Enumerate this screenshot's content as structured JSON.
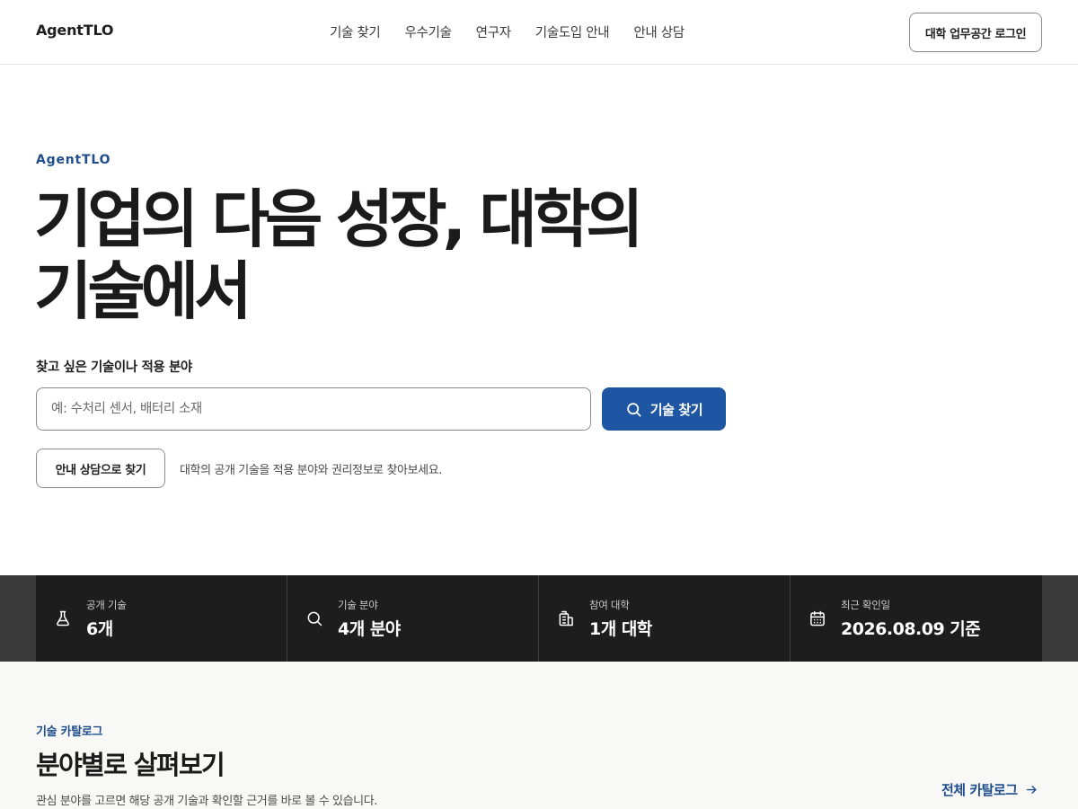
{
  "header": {
    "logo": "AgentTLO",
    "nav": [
      "기술 찾기",
      "우수기술",
      "연구자",
      "기술도입 안내",
      "안내 상담"
    ],
    "login_label": "대학 업무공간 로그인"
  },
  "hero": {
    "eyebrow": "AgentTLO",
    "title_line1": "기업의 다음 성장, 대학의",
    "title_line2": "기술에서",
    "search_label": "찾고 싶은 기술이나 적용 분야",
    "search_value": "",
    "search_placeholder": "예: 수처리 센서, 배터리 소재",
    "search_button": "기술 찾기",
    "consult_button": "안내 상담으로 찾기",
    "helper_text": "대학의 공개 기술을 적용 분야와 권리정보로 찾아보세요."
  },
  "stats": [
    {
      "icon": "flask-icon",
      "label": "공개 기술",
      "value": "6개"
    },
    {
      "icon": "search-icon",
      "label": "기술 분야",
      "value": "4개 분야"
    },
    {
      "icon": "building-icon",
      "label": "참여 대학",
      "value": "1개 대학"
    },
    {
      "icon": "calendar-icon",
      "label": "최근 확인일",
      "value": "2026.08.09 기준"
    }
  ],
  "catalog": {
    "eyebrow": "기술 카탈로그",
    "title": "분야별로 살펴보기",
    "description": "관심 분야를 고르면 해당 공개 기술과 확인할 근거를 바로 볼 수 있습니다.",
    "link_label": "전체 카탈로그"
  },
  "colors": {
    "accent": "#1f56a3",
    "accent_text": "#1f4e8c",
    "stats_bg": "#1d1d1d",
    "catalog_bg": "#f8f8f6"
  }
}
